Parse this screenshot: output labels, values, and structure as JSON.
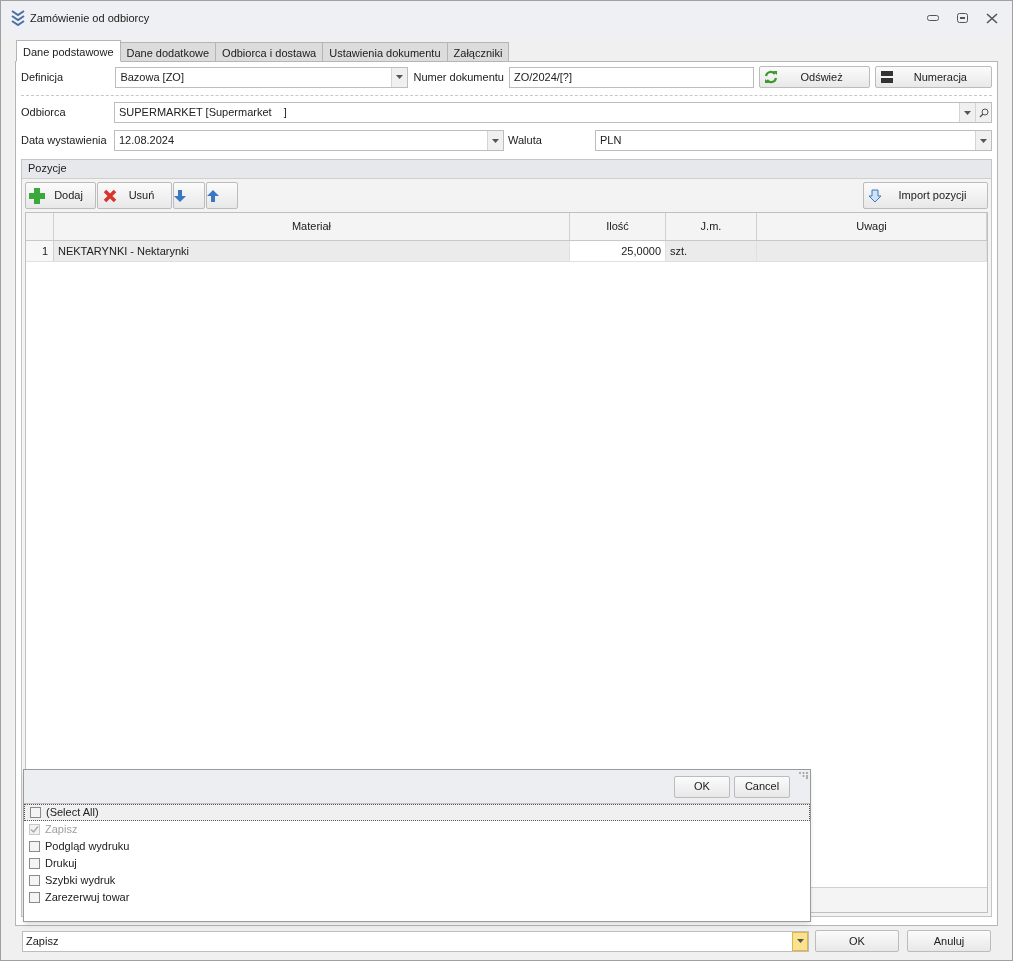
{
  "window": {
    "title": "Zamówienie od odbiorcy"
  },
  "tabs": [
    {
      "label": "Dane podstawowe",
      "selected": true
    },
    {
      "label": "Dane dodatkowe",
      "selected": false
    },
    {
      "label": "Odbiorca i dostawa",
      "selected": false
    },
    {
      "label": "Ustawienia dokumentu",
      "selected": false
    },
    {
      "label": "Załączniki",
      "selected": false
    }
  ],
  "form": {
    "definicja": {
      "label": "Definicja",
      "value": "Bazowa [ZO]"
    },
    "numer": {
      "label": "Numer dokumentu",
      "value": "ZO/2024/[?]"
    },
    "refresh_button": "Odśwież",
    "numbering_button": "Numeracja",
    "odbiorca": {
      "label": "Odbiorca",
      "value": "SUPERMARKET [Supermarket    ]"
    },
    "data": {
      "label": "Data wystawienia",
      "value": "12.08.2024"
    },
    "waluta": {
      "label": "Waluta",
      "value": "PLN"
    }
  },
  "positions": {
    "title": "Pozycje",
    "toolbar": [
      {
        "kind": "add",
        "label": "Dodaj"
      },
      {
        "kind": "delete",
        "label": "Usuń"
      },
      {
        "kind": "down"
      },
      {
        "kind": "up"
      }
    ],
    "import_button": "Import pozycji",
    "table": {
      "columns": [
        "Materiał",
        "Ilość",
        "J.m.",
        "Uwagi"
      ],
      "rows": [
        {
          "number": "1",
          "selected": true,
          "cells": [
            "NEKTARYNKI - Nektarynki",
            "25,0000",
            "szt.",
            ""
          ]
        }
      ]
    }
  },
  "popup": {
    "ok": "OK",
    "cancel": "Cancel",
    "items": [
      {
        "label": "(Select All)",
        "checked": false,
        "disabled": false
      },
      {
        "label": "Zapisz",
        "checked": true,
        "disabled": true
      },
      {
        "label": "Podgląd wydruku",
        "checked": false,
        "disabled": false
      },
      {
        "label": "Drukuj",
        "checked": false,
        "disabled": false
      },
      {
        "label": "Szybki wydruk",
        "checked": false,
        "disabled": false
      },
      {
        "label": "Zarezerwuj towar",
        "checked": false,
        "disabled": false
      }
    ]
  },
  "footer": {
    "action": "Zapisz",
    "ok": "OK",
    "cancel": "Anuluj"
  }
}
